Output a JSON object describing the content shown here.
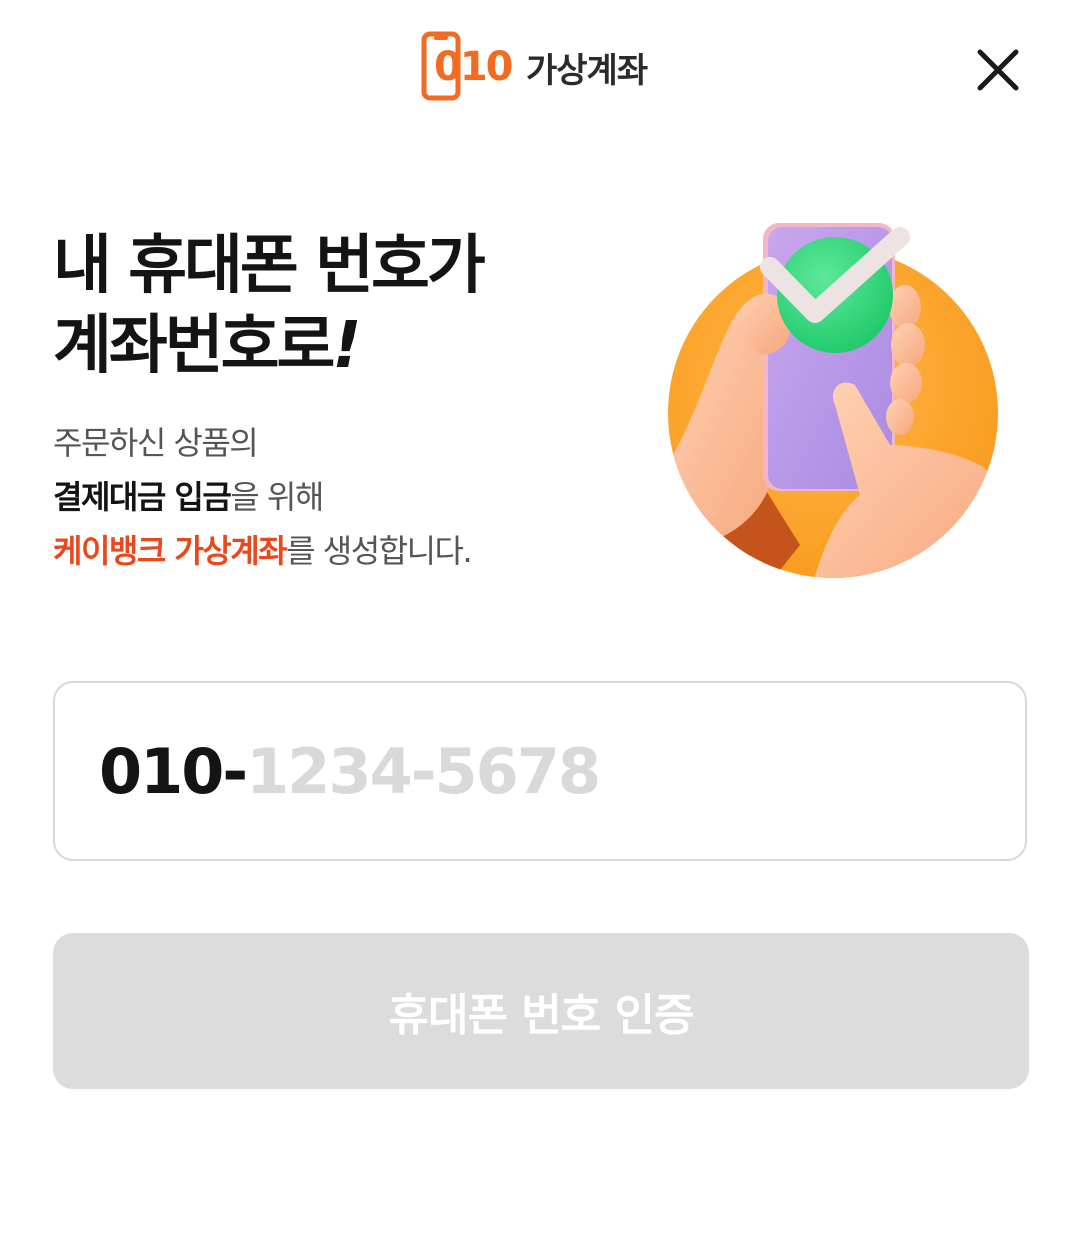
{
  "header": {
    "logo_number": "010",
    "logo_text": "가상계좌",
    "brand_color": "#f26b21",
    "close_icon": "close-icon"
  },
  "hero": {
    "headline_line1": "내 휴대폰 번호가",
    "headline_line2": "계좌번호로",
    "headline_exclaim": "!",
    "desc_line1": "주문하신 상품의",
    "desc_line2_strong": "결제대금 입금",
    "desc_line2_rest": "을 위해",
    "desc_line3_accent": "케이뱅크 가상계좌",
    "desc_line3_rest": "를 생성합니다.",
    "accent_color": "#e8481c",
    "illustration_icon": "phone-check-hands-illustration"
  },
  "phone_input": {
    "prefix": "010-",
    "placeholder": "1234-5678"
  },
  "verify_button": {
    "label": "휴대폰 번호 인증",
    "state": "disabled",
    "bg_color": "#dcdcdc"
  }
}
